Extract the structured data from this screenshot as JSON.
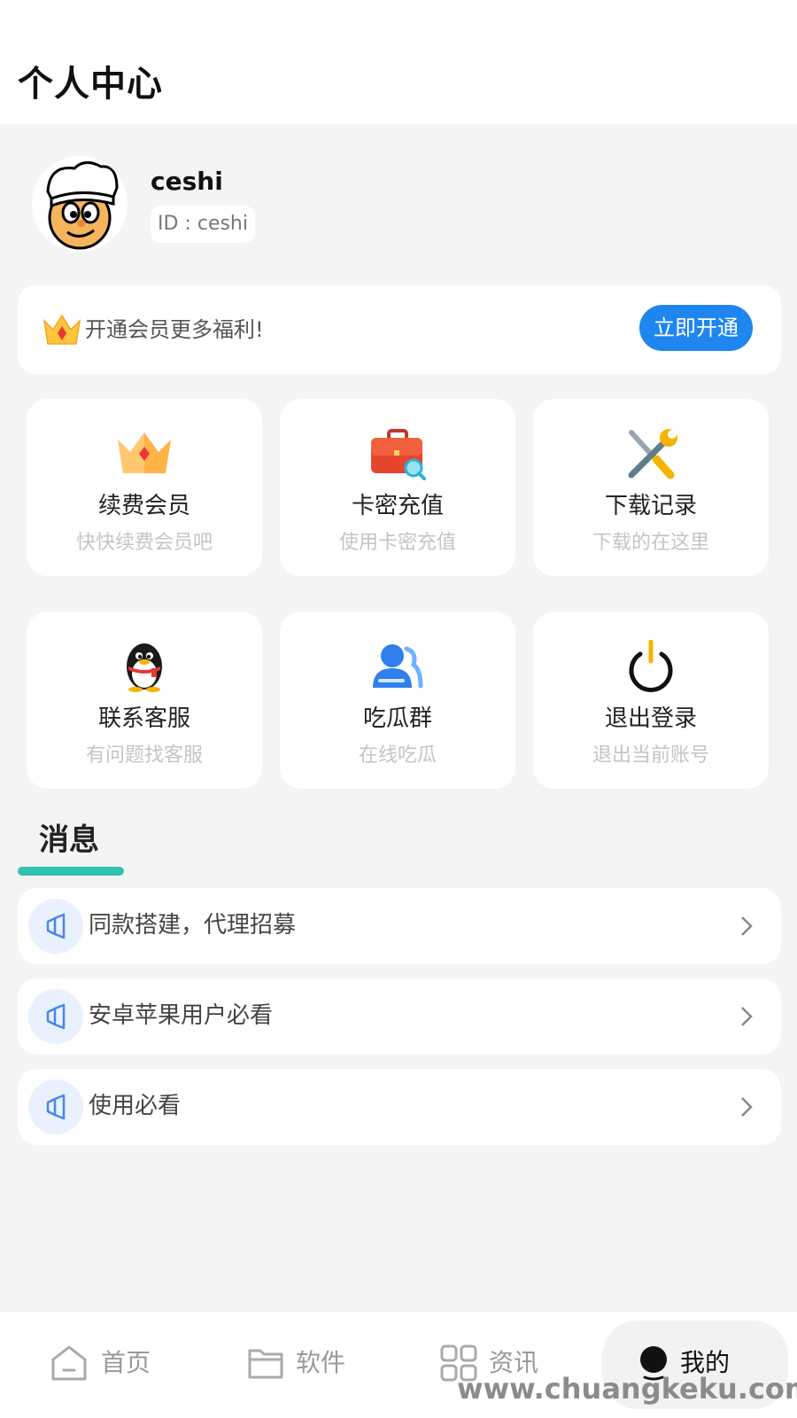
{
  "header": {
    "title": "个人中心"
  },
  "profile": {
    "username": "ceshi",
    "id_label": "ID : ceshi"
  },
  "vip": {
    "text": "开通会员更多福利!",
    "button": "立即开通"
  },
  "grid": [
    {
      "title": "续费会员",
      "subtitle": "快快续费会员吧",
      "icon": "crown-icon"
    },
    {
      "title": "卡密充值",
      "subtitle": "使用卡密充值",
      "icon": "briefcase-search-icon"
    },
    {
      "title": "下载记录",
      "subtitle": "下载的在这里",
      "icon": "tools-icon"
    },
    {
      "title": "联系客服",
      "subtitle": "有问题找客服",
      "icon": "qq-penguin-icon"
    },
    {
      "title": "吃瓜群",
      "subtitle": "在线吃瓜",
      "icon": "group-icon"
    },
    {
      "title": "退出登录",
      "subtitle": "退出当前账号",
      "icon": "power-icon"
    }
  ],
  "messages": {
    "title": "消息",
    "items": [
      {
        "text": "同款搭建，代理招募"
      },
      {
        "text": "安卓苹果用户必看"
      },
      {
        "text": "使用必看"
      }
    ]
  },
  "tabbar": {
    "items": [
      {
        "label": "首页",
        "icon": "home-icon"
      },
      {
        "label": "软件",
        "icon": "folder-icon"
      },
      {
        "label": "资讯",
        "icon": "apps-grid-icon"
      },
      {
        "label": "我的",
        "icon": "user-icon",
        "active": true
      }
    ]
  },
  "watermark": "www.chuangkeku.com",
  "colors": {
    "accent": "#1f86f0",
    "message_underline": "#31c2b0",
    "background": "#f4f4f4"
  }
}
